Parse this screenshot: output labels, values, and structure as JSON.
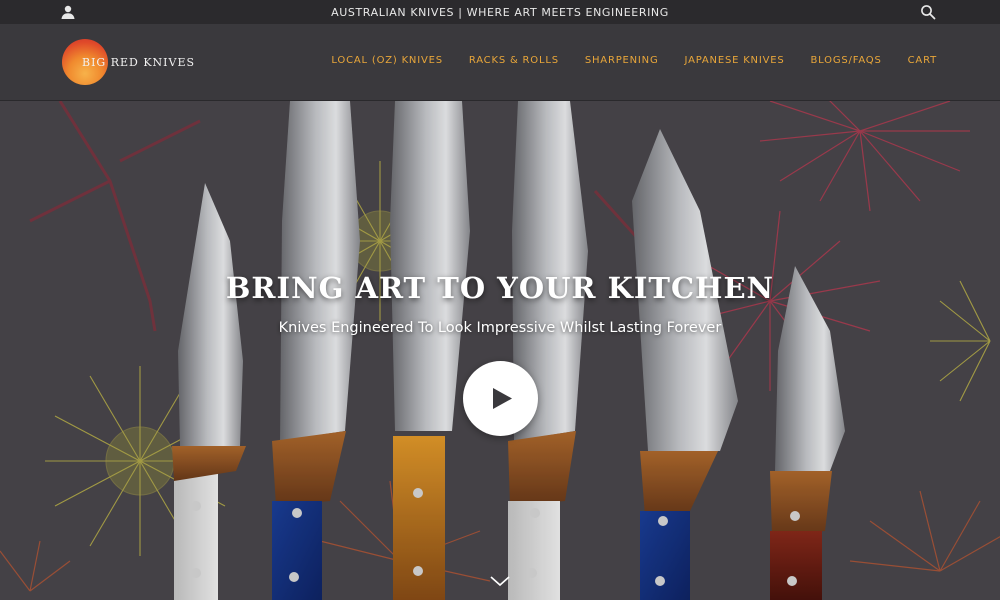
{
  "topbar": {
    "announcement": "AUSTRALIAN KNIVES | WHERE ART MEETS ENGINEERING",
    "account_icon": "user-icon",
    "search_icon": "search-icon"
  },
  "header": {
    "logo_text": "BIG RED KNIVES",
    "nav": [
      {
        "label": "LOCAL (OZ) KNIVES"
      },
      {
        "label": "RACKS & ROLLS"
      },
      {
        "label": "SHARPENING"
      },
      {
        "label": "JAPANESE KNIVES"
      },
      {
        "label": "BLOGS/FAQS"
      },
      {
        "label": "CART"
      }
    ]
  },
  "hero": {
    "title": "BRING ART TO YOUR KITCHEN",
    "subtitle": "Knives Engineered To Look Impressive Whilst Lasting Forever",
    "play_icon": "play-icon",
    "scroll_icon": "chevron-down-icon"
  },
  "colors": {
    "topbar_bg": "#2b2a2d",
    "header_bg": "#3a393d",
    "nav_accent": "#e8a63a",
    "hero_bg": "#4a474c"
  }
}
